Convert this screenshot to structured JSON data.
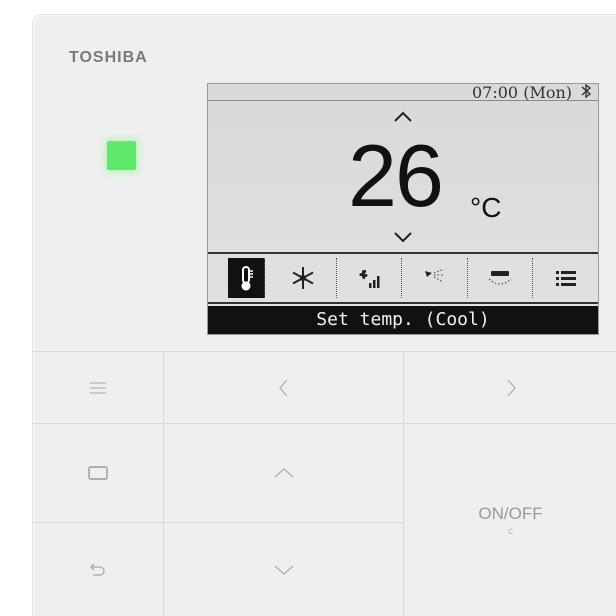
{
  "brand": {
    "name": "TOSHIBA"
  },
  "display": {
    "clock": "07:00 (Mon)",
    "bluetooth_icon": "bluetooth-icon",
    "temperature": "26",
    "unit": "°C",
    "status": "Set temp. (Cool)",
    "menu_icons": [
      {
        "name": "thermometer-icon",
        "selected": true
      },
      {
        "name": "snowflake-icon",
        "selected": false
      },
      {
        "name": "fan-speed-icon",
        "selected": false
      },
      {
        "name": "louver-icon",
        "selected": false
      },
      {
        "name": "swing-icon",
        "selected": false
      },
      {
        "name": "list-menu-icon",
        "selected": false
      }
    ]
  },
  "led": {
    "color": "#5fe86a"
  },
  "buttons": {
    "menu": "menu-icon",
    "left": "chevron-left-icon",
    "right": "chevron-right-icon",
    "square": "square-icon",
    "up": "chevron-up-icon",
    "down": "chevron-down-icon",
    "back": "back-icon",
    "power_label": "ON/OFF"
  }
}
